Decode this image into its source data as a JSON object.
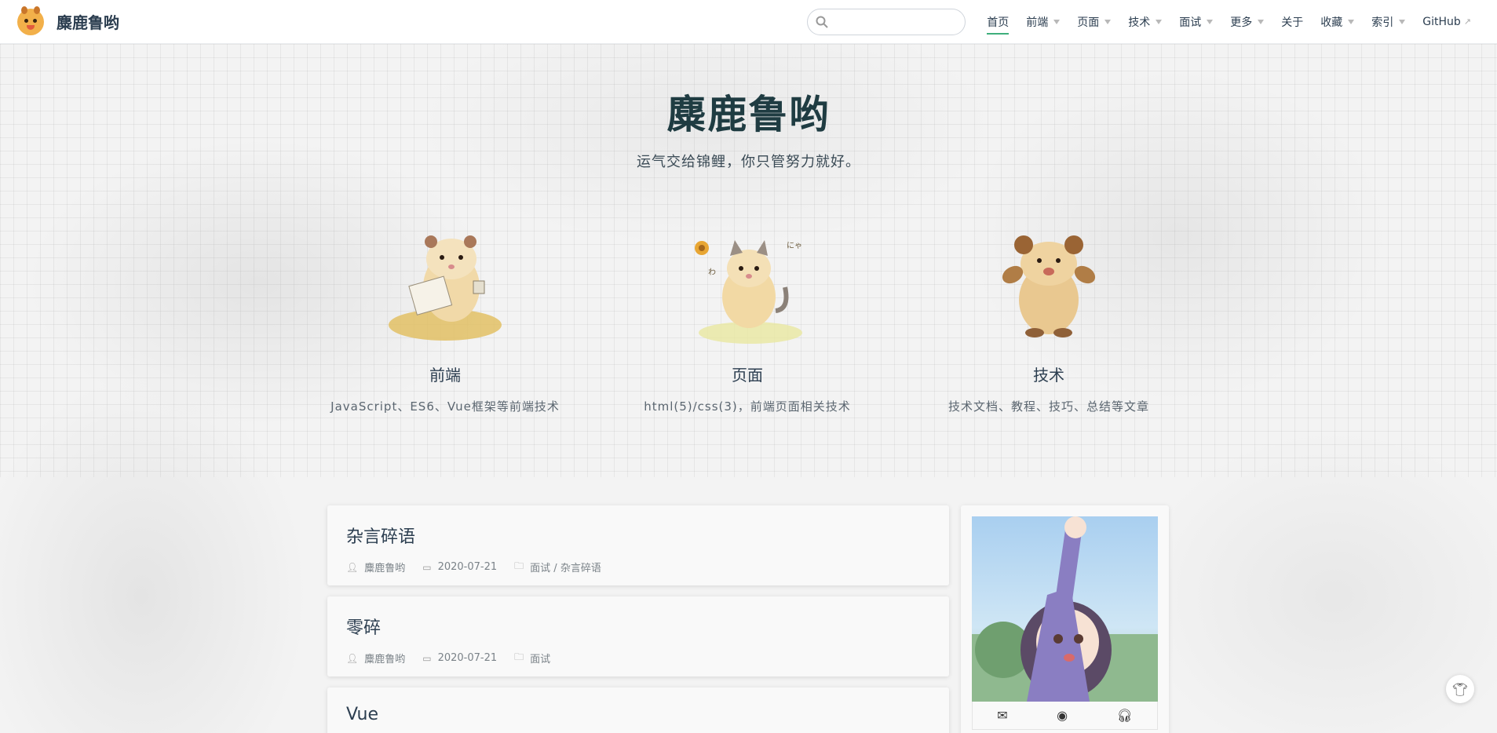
{
  "site": {
    "name": "麋鹿鲁哟"
  },
  "nav": {
    "search_placeholder": "",
    "items": [
      {
        "label": "首页",
        "active": true,
        "dropdown": false
      },
      {
        "label": "前端",
        "dropdown": true
      },
      {
        "label": "页面",
        "dropdown": true
      },
      {
        "label": "技术",
        "dropdown": true
      },
      {
        "label": "面试",
        "dropdown": true
      },
      {
        "label": "更多",
        "dropdown": true
      },
      {
        "label": "关于",
        "dropdown": false
      },
      {
        "label": "收藏",
        "dropdown": true
      },
      {
        "label": "索引",
        "dropdown": true
      },
      {
        "label": "GitHub",
        "external": true
      }
    ]
  },
  "hero": {
    "title": "麋鹿鲁哟",
    "description": "运气交给锦鲤，你只管努力就好。",
    "features": [
      {
        "name": "前端",
        "desc": "JavaScript、ES6、Vue框架等前端技术",
        "icon": "hamster-reading-icon"
      },
      {
        "name": "页面",
        "desc": "html(5)/css(3)，前端页面相关技术",
        "icon": "hamster-cat-icon"
      },
      {
        "name": "技术",
        "desc": "技术文档、教程、技巧、总结等文章",
        "icon": "hamster-bear-icon"
      }
    ]
  },
  "posts": [
    {
      "title": "杂言碎语",
      "author": "麋鹿鲁哟",
      "date": "2020-07-21",
      "category": "面试 / 杂言碎语"
    },
    {
      "title": "零碎",
      "author": "麋鹿鲁哟",
      "date": "2020-07-21",
      "category": "面试"
    },
    {
      "title": "Vue",
      "author": "",
      "date": "",
      "category": ""
    }
  ],
  "sidebar": {
    "social": [
      {
        "icon": "mail-icon"
      },
      {
        "icon": "github-icon"
      },
      {
        "icon": "headphones-icon"
      }
    ]
  },
  "colors": {
    "accent": "#3eaf7c",
    "title": "#1f3c42"
  }
}
